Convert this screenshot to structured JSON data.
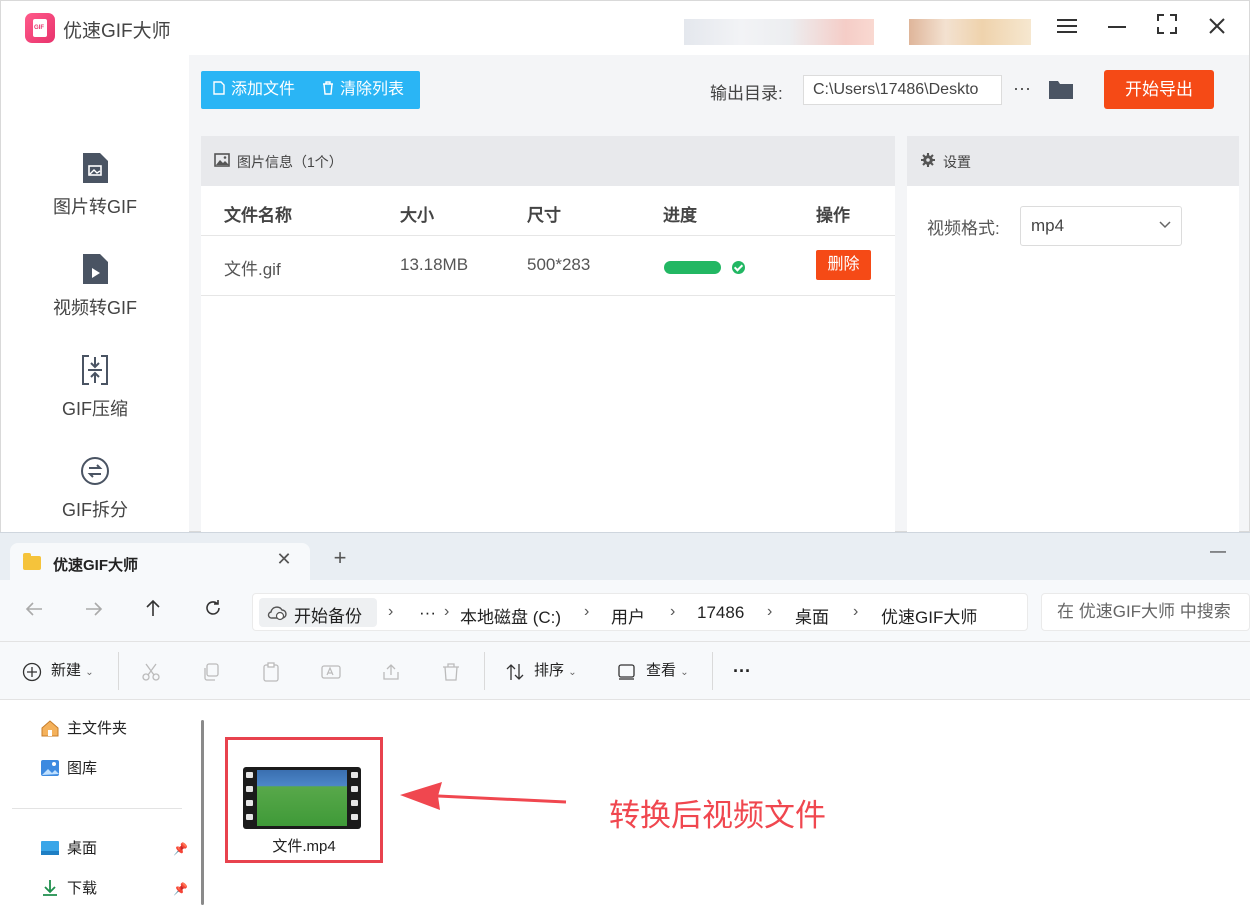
{
  "app": {
    "title": "优速GIF大师",
    "logo_text": "GIF",
    "window_controls": [
      "menu-icon",
      "minimize-icon",
      "maximize-icon",
      "close-icon"
    ]
  },
  "sidebar": {
    "items": [
      {
        "label": "图片转GIF",
        "icon": "image-file-icon"
      },
      {
        "label": "视频转GIF",
        "icon": "video-file-icon"
      },
      {
        "label": "GIF压缩",
        "icon": "compress-icon"
      },
      {
        "label": "GIF拆分",
        "icon": "split-icon"
      }
    ]
  },
  "toolbar": {
    "add_file": "添加文件",
    "clear_list": "清除列表",
    "output_label": "输出目录:",
    "output_path": "C:\\Users\\17486\\Deskto",
    "more": "···",
    "export": "开始导出"
  },
  "file_panel": {
    "title": "图片信息（1个）",
    "columns": [
      "文件名称",
      "大小",
      "尺寸",
      "进度",
      "操作"
    ],
    "rows": [
      {
        "name": "文件.gif",
        "size": "13.18MB",
        "dims": "500*283",
        "progress": 1.0,
        "action": "删除"
      }
    ]
  },
  "settings": {
    "title": "设置",
    "format_label": "视频格式:",
    "format_value": "mp4"
  },
  "explorer": {
    "tab_title": "优速GIF大师",
    "tab_close": "✕",
    "tab_add": "+",
    "minimize": "—",
    "breadcrumbs": [
      "开始备份",
      "···",
      "本地磁盘 (C:)",
      "用户",
      "17486",
      "桌面",
      "优速GIF大师"
    ],
    "search_placeholder": "在 优速GIF大师 中搜索",
    "commands": {
      "new": "新建",
      "sort": "排序",
      "view": "查看",
      "more": "···"
    },
    "nav_items": [
      {
        "label": "主文件夹",
        "icon": "home-icon"
      },
      {
        "label": "图库",
        "icon": "gallery-icon"
      },
      {
        "label": "桌面",
        "icon": "desktop-icon"
      },
      {
        "label": "下载",
        "icon": "download-icon"
      }
    ],
    "file": {
      "name": "文件.mp4"
    }
  },
  "annotation": {
    "text": "转换后视频文件",
    "color": "#f0474f"
  },
  "colors": {
    "accent_blue": "#2ab5f5",
    "export_orange": "#f54a16",
    "progress_green": "#22b763"
  }
}
